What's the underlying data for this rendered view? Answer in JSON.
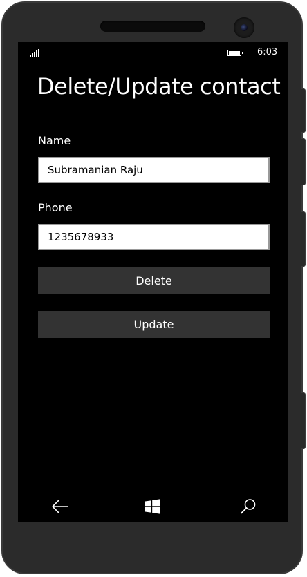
{
  "status_bar": {
    "time": "6:03",
    "signal_icon": "signal-strength-icon",
    "battery_icon": "battery-icon"
  },
  "page": {
    "title": "Delete/Update contact"
  },
  "form": {
    "name_label": "Name",
    "name_value": "Subramanian Raju",
    "phone_label": "Phone",
    "phone_value": "1235678933"
  },
  "actions": {
    "delete_label": "Delete",
    "update_label": "Update"
  },
  "nav_bar": {
    "back_icon": "back-arrow-icon",
    "home_icon": "windows-logo-icon",
    "search_icon": "search-icon"
  },
  "colors": {
    "screen_background": "#000000",
    "text": "#ffffff",
    "input_background": "#ffffff",
    "input_border": "#999999",
    "button_background": "#333333",
    "device_frame": "#2b2b2b"
  }
}
